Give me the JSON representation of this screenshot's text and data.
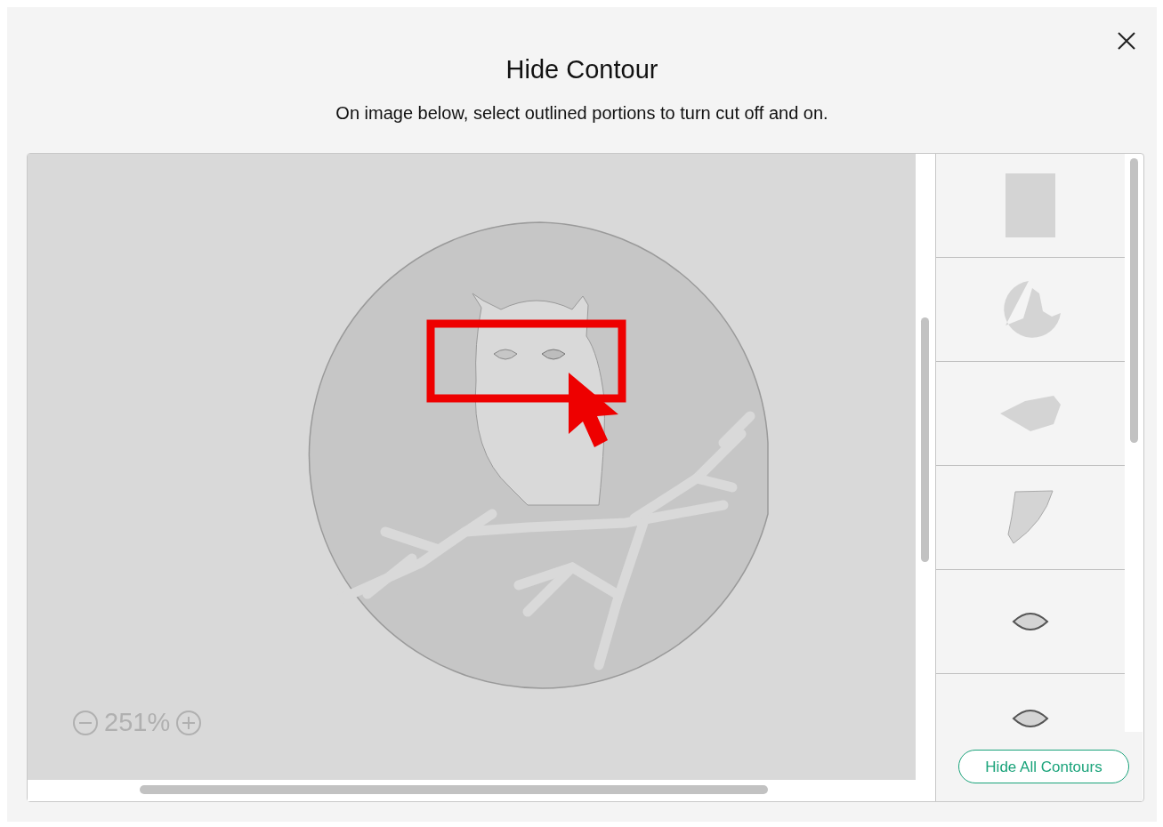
{
  "dialog": {
    "title": "Hide Contour",
    "instructions": "On image below, select outlined portions to turn cut off and on."
  },
  "canvas": {
    "zoom_reading": "251%"
  },
  "contours": [
    {
      "kind": "rectangle"
    },
    {
      "kind": "ring"
    },
    {
      "kind": "branch"
    },
    {
      "kind": "wedge"
    },
    {
      "kind": "eye"
    },
    {
      "kind": "eye-cut"
    }
  ],
  "hide_all_button": "Hide All Contours"
}
